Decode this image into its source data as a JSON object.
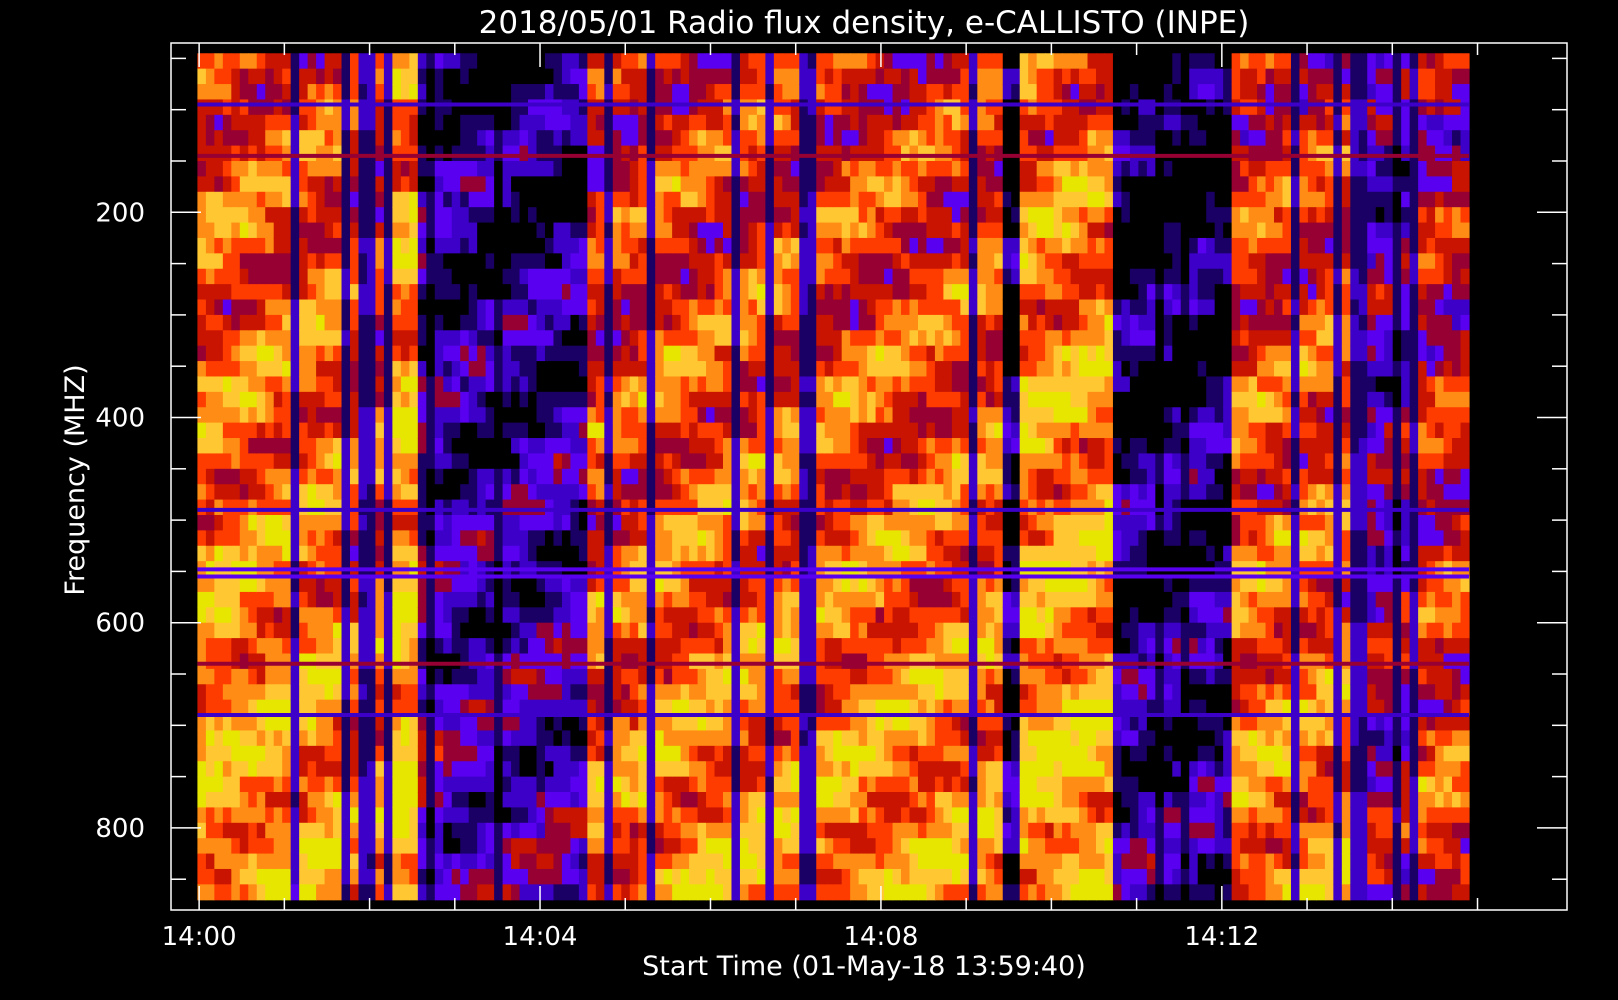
{
  "chart_data": {
    "type": "heatmap",
    "title": "2018/05/01  Radio flux density, e-CALLISTO (INPE)",
    "xlabel": "Start Time (01-May-18 13:59:40)",
    "ylabel": "Frequency (MHZ)",
    "x_unit": "minutes after 14:00",
    "xlim": [
      -0.33,
      16.05
    ],
    "ylim": [
      880,
      35
    ],
    "data_x_range": [
      -0.02,
      14.9
    ],
    "data_y_range": [
      45,
      870
    ],
    "x_ticks": [
      {
        "value": 0,
        "label": "14:00"
      },
      {
        "value": 4,
        "label": "14:04"
      },
      {
        "value": 8,
        "label": "14:08"
      },
      {
        "value": 12,
        "label": "14:12"
      }
    ],
    "x_minor_ticks": [
      1,
      2,
      3,
      5,
      6,
      7,
      9,
      10,
      11,
      13,
      14,
      15
    ],
    "y_ticks": [
      {
        "value": 200,
        "label": "200"
      },
      {
        "value": 400,
        "label": "400"
      },
      {
        "value": 600,
        "label": "600"
      },
      {
        "value": 800,
        "label": "800"
      }
    ],
    "y_minor_ticks": [
      50,
      100,
      150,
      250,
      300,
      350,
      450,
      500,
      550,
      650,
      700,
      750,
      850
    ],
    "colormap": [
      "#000000",
      "#1a0064",
      "#3c00c8",
      "#5a00f0",
      "#960032",
      "#c81400",
      "#ff3c00",
      "#ff8c14",
      "#ffc832",
      "#e6e600"
    ],
    "intensity_segments": [
      {
        "x0": -0.02,
        "x1": 1.7,
        "level": 0.72
      },
      {
        "x0": 1.7,
        "x1": 2.3,
        "level": 0.62
      },
      {
        "x0": 2.3,
        "x1": 2.55,
        "level": 0.82
      },
      {
        "x0": 2.55,
        "x1": 2.85,
        "level": 0.25
      },
      {
        "x0": 2.85,
        "x1": 4.55,
        "level": 0.18
      },
      {
        "x0": 4.55,
        "x1": 5.2,
        "level": 0.62
      },
      {
        "x0": 5.2,
        "x1": 9.4,
        "level": 0.68
      },
      {
        "x0": 9.4,
        "x1": 9.6,
        "level": 0.05
      },
      {
        "x0": 9.6,
        "x1": 10.75,
        "level": 0.78
      },
      {
        "x0": 10.75,
        "x1": 11.9,
        "level": 0.1
      },
      {
        "x0": 11.9,
        "x1": 12.15,
        "level": 0.05
      },
      {
        "x0": 12.15,
        "x1": 13.7,
        "level": 0.66
      },
      {
        "x0": 13.7,
        "x1": 14.2,
        "level": 0.35
      },
      {
        "x0": 14.2,
        "x1": 14.9,
        "level": 0.55
      }
    ],
    "dropout_columns": [
      1.1,
      1.75,
      1.95,
      2.05,
      2.2,
      2.7,
      3.5,
      4.8,
      5.3,
      6.3,
      6.65,
      7.1,
      7.2,
      9.1,
      11.25,
      11.6,
      12.9,
      13.35,
      13.55,
      13.65,
      14.05,
      14.3
    ],
    "interference_lines": [
      {
        "freq": 95,
        "color": "#3c00c8"
      },
      {
        "freq": 145,
        "color": "#960032"
      },
      {
        "freq": 490,
        "color": "#3c00c8"
      },
      {
        "freq": 548,
        "color": "#5a00f0"
      },
      {
        "freq": 555,
        "color": "#5a00f0"
      },
      {
        "freq": 640,
        "color": "#960032"
      },
      {
        "freq": 690,
        "color": "#3c00c8"
      }
    ]
  }
}
